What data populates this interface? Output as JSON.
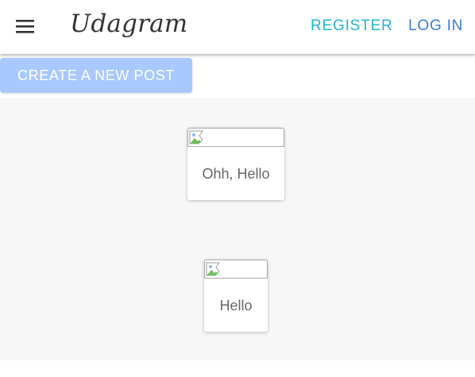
{
  "header": {
    "brand": "Udagram",
    "menu_icon": "hamburger-menu-icon",
    "nav": {
      "register": "REGISTER",
      "login": "LOG IN"
    }
  },
  "actions": {
    "create_post": "CREATE A NEW POST"
  },
  "feed": {
    "posts": [
      {
        "caption": "Ohh, Hello",
        "image_icon": "broken-image-icon"
      },
      {
        "caption": "Hello",
        "image_icon": "broken-image-icon"
      }
    ]
  },
  "colors": {
    "register_link": "#1fb6cf",
    "login_link": "#3a7bd5",
    "create_button_bg": "#a9c8ff",
    "feed_bg": "#f7f7f7",
    "brand_text": "#333333"
  }
}
